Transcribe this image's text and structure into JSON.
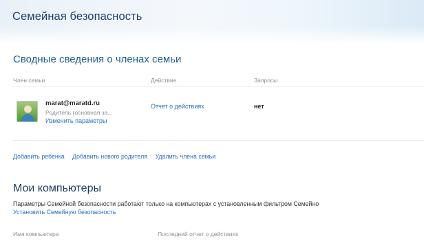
{
  "app": {
    "title": "Семейная безопасность"
  },
  "members": {
    "title": "Сводные сведения о членах семьи",
    "columns": [
      "Член семьи",
      "Действие",
      "Запросы"
    ],
    "rows": [
      {
        "email": "marat@maratd.ru",
        "role": "Родитель (основная за...",
        "edit_link": "Изменить параметры",
        "action": "Отчет о действиях",
        "requests": "нет"
      }
    ],
    "actions": [
      "Добавить ребенка",
      "Добавить нового родителя",
      "Удалить члена семьи"
    ]
  },
  "computers": {
    "title": "Мои компьютеры",
    "info": "Параметры Семейной безопасности работают только на компьютерах с установленным фильтром Семейно",
    "setup_link": "Установить Семейную безопасность",
    "columns": [
      "Имя компьютера",
      "Последний отчет о действиях"
    ]
  },
  "colors": {
    "link": "#2a6fc4",
    "heading": "#1f5f8f",
    "title": "#1c3e6e"
  }
}
